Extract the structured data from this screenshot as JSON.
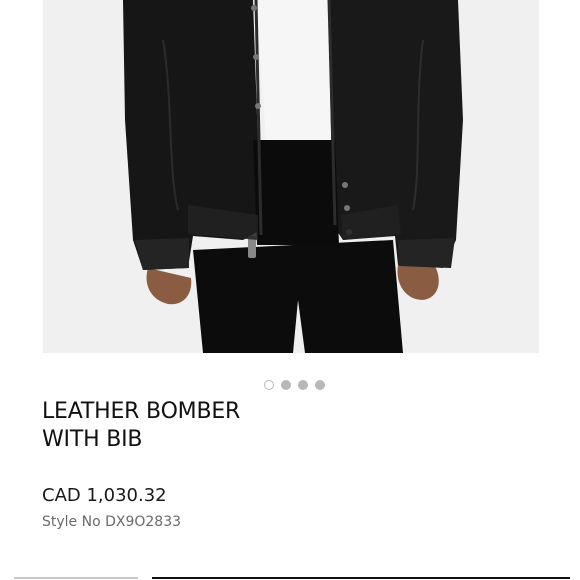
{
  "product": {
    "name_line1": "LEATHER BOMBER",
    "name_line2": "WITH BIB",
    "price": "CAD 1,030.32",
    "style_no": "Style No DX9O2833"
  },
  "gallery": {
    "image_label": "Leather bomber jacket product photo",
    "dots": 4,
    "active_index": 0
  }
}
